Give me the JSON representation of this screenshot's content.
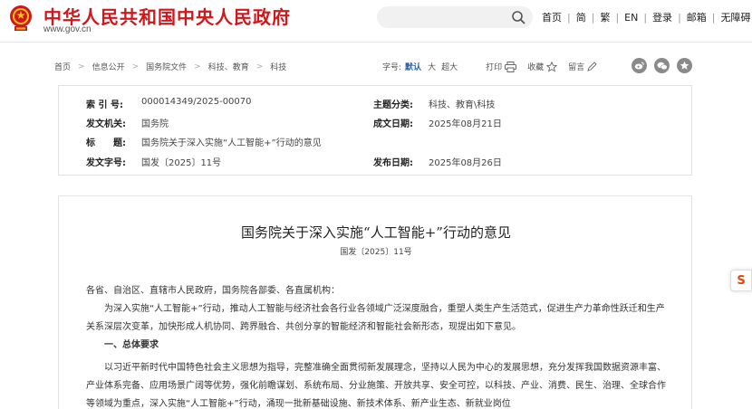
{
  "header": {
    "site_title": "中华人民共和国中央人民政府",
    "site_url": "www.gov.cn",
    "search": {
      "value": "",
      "placeholder": ""
    },
    "nav": [
      {
        "label": "首页"
      },
      {
        "label": "简"
      },
      {
        "label": "繁"
      },
      {
        "label": "EN"
      },
      {
        "label": "登录"
      },
      {
        "label": "邮箱"
      },
      {
        "label": "无障碍"
      }
    ]
  },
  "breadcrumb": [
    "首页",
    "信息公开",
    "国务院文件",
    "科技、教育",
    "科技"
  ],
  "tools": {
    "font_size_label": "字号:",
    "font_sizes": {
      "default": "默认",
      "large": "大",
      "xlarge": "超大"
    },
    "print": "打印",
    "favorite": "收藏",
    "comment": "留言"
  },
  "meta": {
    "index_label": "索 引 号:",
    "index_value": "000014349/2025-00070",
    "category_label": "主题分类:",
    "category_value": "科技、教育\\科技",
    "issuer_label": "发文机关:",
    "issuer_value": "国务院",
    "date_written_label": "成文日期:",
    "date_written_value": "2025年08月21日",
    "title_label": "标　　题:",
    "title_value": "国务院关于深入实施“人工智能+”行动的意见",
    "doc_no_label": "发文字号:",
    "doc_no_value": "国发〔2025〕11号",
    "publish_label": "发布日期:",
    "publish_value": "2025年08月26日"
  },
  "article": {
    "title": "国务院关于深入实施“人工智能+”行动的意见",
    "doc_number": "国发〔2025〕11号",
    "salutation": "各省、自治区、直辖市人民政府，国务院各部委、各直属机构：",
    "intro": "为深入实施“人工智能+”行动，推动人工智能与经济社会各行业各领域广泛深度融合，重塑人类生产生活范式，促进生产力革命性跃迁和生产关系深层次变革，加快形成人机协同、跨界融合、共创分享的智能经济和智能社会新形态，现提出如下意见。",
    "section_heading": "一、总体要求",
    "body": "以习近平新时代中国特色社会主义思想为指导，完整准确全面贯彻新发展理念，坚持以人民为中心的发展思想，充分发挥我国数据资源丰富、产业体系完备、应用场景广阔等优势，强化前瞻谋划、系统布局、分业施策、开放共享、安全可控，以科技、产业、消费、民生、治理、全球合作等领域为重点，深入实施“人工智能+”行动，涌现一批新基础设施、新技术体系、新产业生态、新就业岗位"
  },
  "side_button": {
    "label": "S"
  },
  "colors": {
    "brand_red": "#d0171b",
    "active_blue": "#2a5ea8",
    "share_gray": "#8a8a8a"
  }
}
